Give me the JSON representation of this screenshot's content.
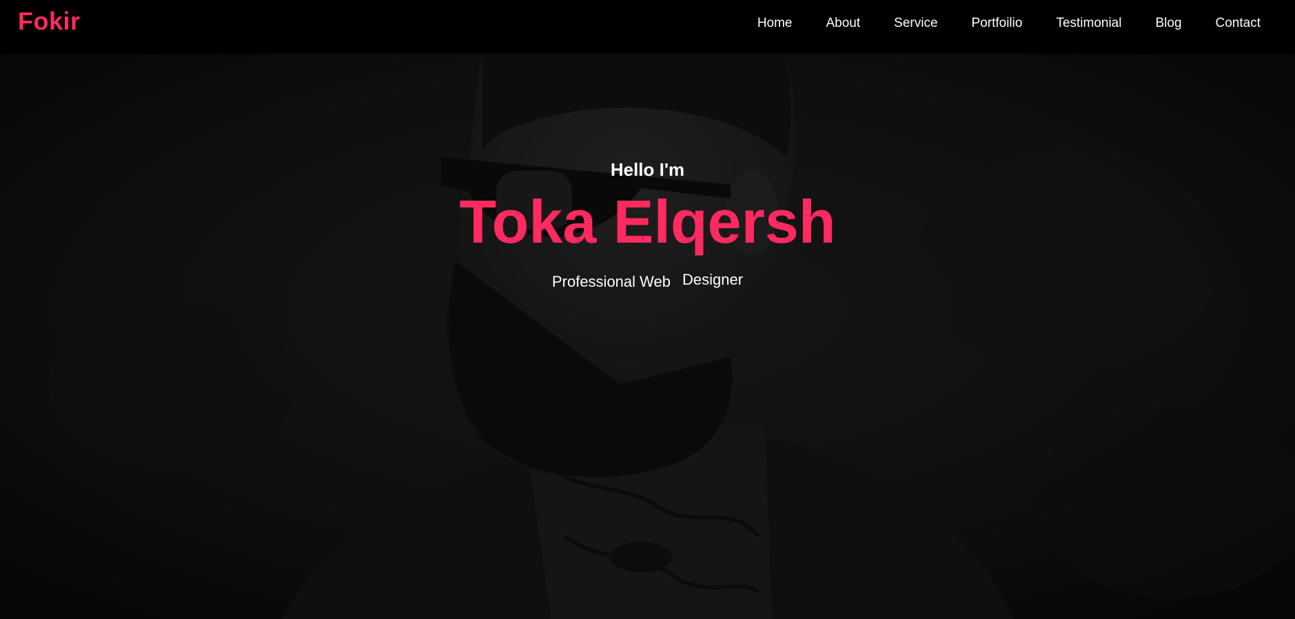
{
  "brand": {
    "logo": "Fokir",
    "accent_color": "#ff2a5f"
  },
  "nav": {
    "items": [
      {
        "label": "Home"
      },
      {
        "label": "About"
      },
      {
        "label": "Service"
      },
      {
        "label": "Portfoilio"
      },
      {
        "label": "Testimonial"
      },
      {
        "label": "Blog"
      },
      {
        "label": "Contact"
      }
    ]
  },
  "hero": {
    "greeting": "Hello I'm",
    "name": "Toka Elqersh",
    "role_part_1": "Professional Web",
    "role_part_2": "Designer",
    "background_image": "bearded-man-sunglasses-tattoo-portrait"
  }
}
